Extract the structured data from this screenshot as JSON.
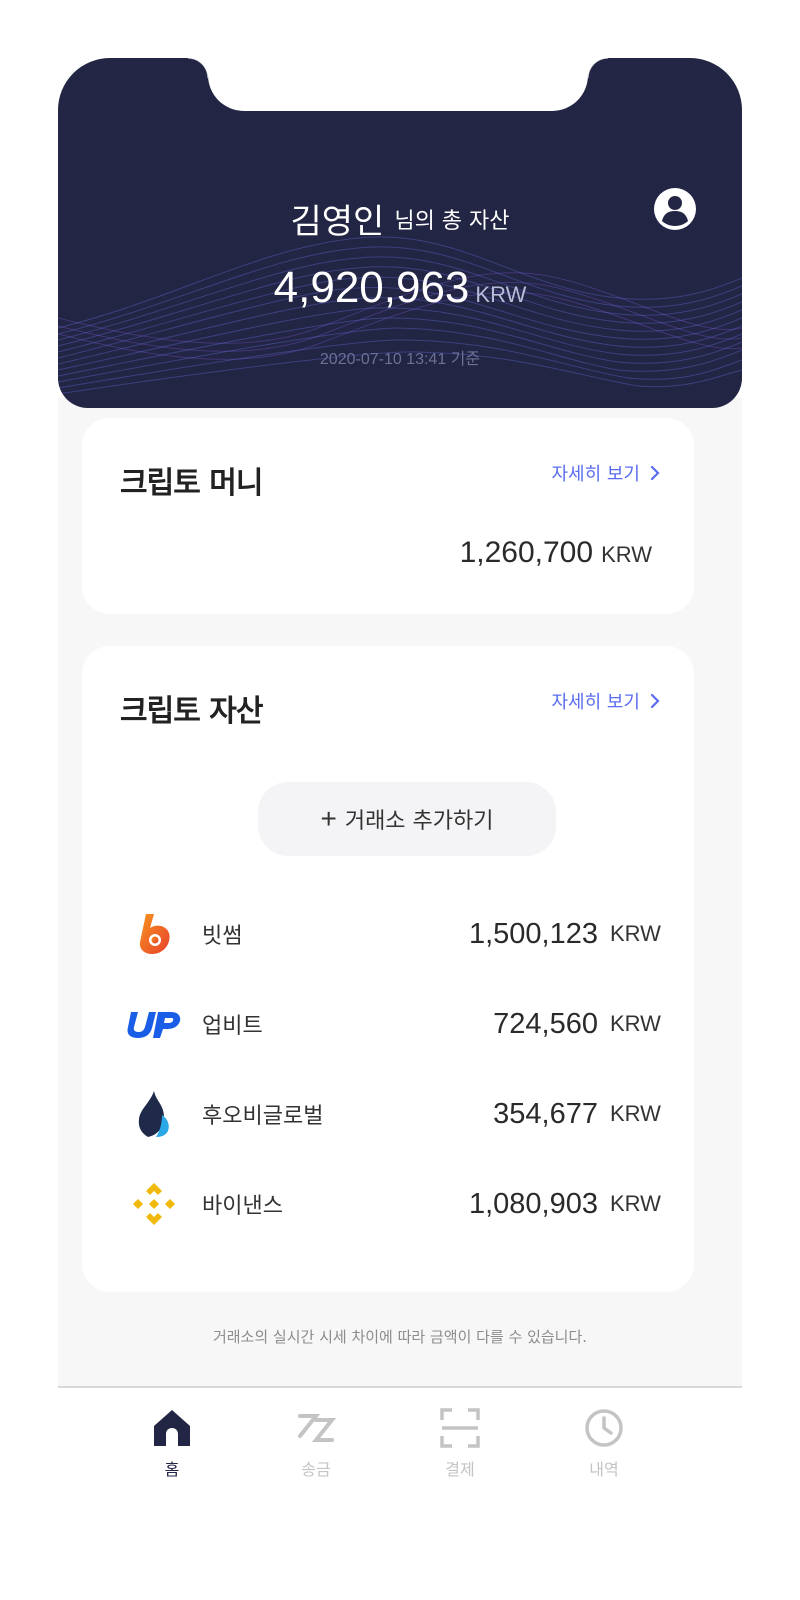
{
  "header": {
    "user_name": "김영인",
    "greeting_suffix": "님의 총 자산",
    "total_amount": "4,920,963",
    "total_unit": "KRW",
    "as_of": "2020-07-10  13:41 기준"
  },
  "crypto_money": {
    "title": "크립토 머니",
    "more_label": "자세히 보기",
    "amount": "1,260,700",
    "unit": "KRW"
  },
  "crypto_assets": {
    "title": "크립토 자산",
    "more_label": "자세히 보기",
    "add_exchange_label": "거래소 추가하기",
    "exchanges": [
      {
        "name": "빗썸",
        "amount": "1,500,123",
        "unit": "KRW",
        "icon": "bithumb-logo"
      },
      {
        "name": "업비트",
        "amount": "724,560",
        "unit": "KRW",
        "icon": "upbit-logo"
      },
      {
        "name": "후오비글로벌",
        "amount": "354,677",
        "unit": "KRW",
        "icon": "huobi-logo"
      },
      {
        "name": "바이낸스",
        "amount": "1,080,903",
        "unit": "KRW",
        "icon": "binance-logo"
      }
    ]
  },
  "disclaimer": "거래소의 실시간 시세 차이에 따라 금액이 다를 수 있습니다.",
  "tabbar": {
    "items": [
      {
        "label": "홈",
        "icon": "home-icon",
        "active": true
      },
      {
        "label": "송금",
        "icon": "transfer-icon",
        "active": false
      },
      {
        "label": "결제",
        "icon": "scan-icon",
        "active": false
      },
      {
        "label": "내역",
        "icon": "clock-icon",
        "active": false
      }
    ]
  },
  "colors": {
    "header_bg": "#222543",
    "accent_link": "#5a6cf0",
    "tab_active": "#222543",
    "tab_inactive": "#c4c4c4"
  }
}
